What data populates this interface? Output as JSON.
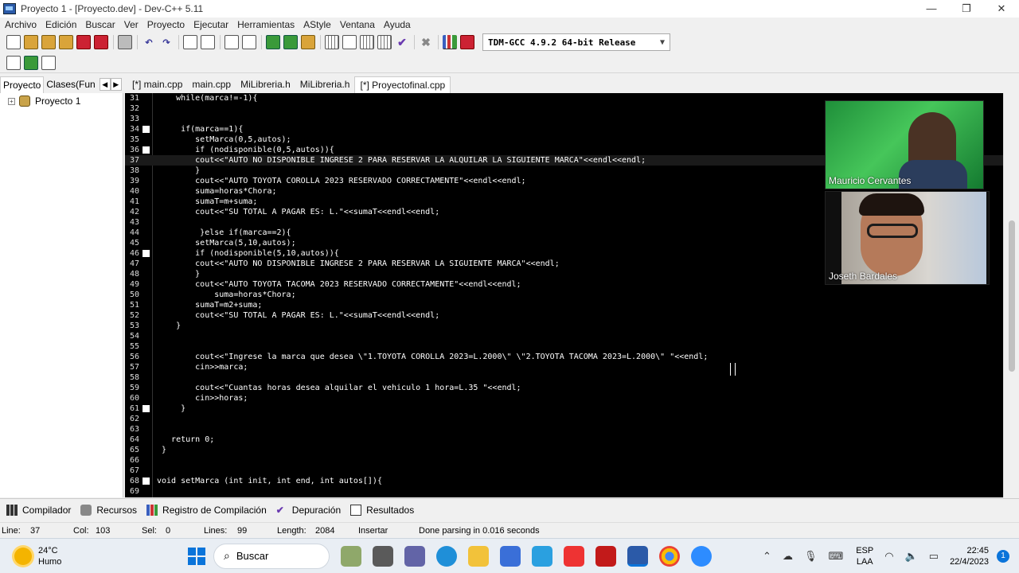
{
  "window": {
    "title": "Proyecto 1 - [Proyecto.dev] - Dev-C++ 5.11",
    "minimize": "—",
    "maximize": "❐",
    "close": "✕"
  },
  "menu": [
    "Archivo",
    "Edición",
    "Buscar",
    "Ver",
    "Proyecto",
    "Ejecutar",
    "Herramientas",
    "AStyle",
    "Ventana",
    "Ayuda"
  ],
  "toolbar": {
    "compiler": "TDM-GCC 4.9.2 64-bit Release",
    "icons": [
      "new-file-icon",
      "open-icon",
      "save-icon",
      "save-all-icon",
      "close-icon",
      "close-all-icon",
      "print-icon",
      "undo-icon",
      "redo-icon",
      "find-icon",
      "replace-icon",
      "indent-icon",
      "unindent-icon",
      "goto-icon",
      "toggle-bookmark-icon",
      "compile-icon",
      "run-icon",
      "compile-run-icon",
      "rebuild-icon",
      "grid-icon",
      "check-icon",
      "stop-icon",
      "chart-icon",
      "debug-icon"
    ]
  },
  "left_tabs": [
    "Proyecto",
    "Clases(Fun"
  ],
  "editor_tabs": [
    "[*] main.cpp",
    "main.cpp",
    "MiLibreria.h",
    "MiLibreria.h",
    "[*] Proyectofinal.cpp"
  ],
  "project_tree": {
    "root": "Proyecto 1"
  },
  "editor": {
    "current_line": 37,
    "lines": [
      {
        "n": 31,
        "fold": false,
        "text": "    while(marca!=-1){",
        "color": "#ffffff"
      },
      {
        "n": 32,
        "fold": false,
        "text": "",
        "color": "#ffffff"
      },
      {
        "n": 33,
        "fold": false,
        "text": "",
        "color": "#ffffff"
      },
      {
        "n": 34,
        "fold": true,
        "text": "     if(marca==1){",
        "color": "#ffffff"
      },
      {
        "n": 35,
        "fold": false,
        "text": "        setMarca(0,5,autos);",
        "color": "#ffffff"
      },
      {
        "n": 36,
        "fold": true,
        "text": "        if (nodisponible(0,5,autos)){",
        "color": "#ffffff"
      },
      {
        "n": 37,
        "fold": false,
        "text": "        cout<<\"AUTO NO DISPONIBLE INGRESE 2 PARA RESERVAR LA ALQUILAR LA SIGUIENTE MARCA\"<<endl<<endl;",
        "color": "#ffffff"
      },
      {
        "n": 38,
        "fold": false,
        "text": "        }",
        "color": "#ffffff"
      },
      {
        "n": 39,
        "fold": false,
        "text": "        cout<<\"AUTO TOYOTA COROLLA 2023 RESERVADO CORRECTAMENTE\"<<endl<<endl;",
        "color": "#ffffff"
      },
      {
        "n": 40,
        "fold": false,
        "text": "        suma=horas*Chora;",
        "color": "#ffffff"
      },
      {
        "n": 41,
        "fold": false,
        "text": "        sumaT=m+suma;",
        "color": "#ffffff"
      },
      {
        "n": 42,
        "fold": false,
        "text": "        cout<<\"SU TOTAL A PAGAR ES: L.\"<<sumaT<<endl<<endl;",
        "color": "#ffffff"
      },
      {
        "n": 43,
        "fold": false,
        "text": "",
        "color": "#ffffff"
      },
      {
        "n": 44,
        "fold": false,
        "text": "         }else if(marca==2){",
        "color": "#ffffff"
      },
      {
        "n": 45,
        "fold": false,
        "text": "        setMarca(5,10,autos);",
        "color": "#ffffff"
      },
      {
        "n": 46,
        "fold": true,
        "text": "        if (nodisponible(5,10,autos)){",
        "color": "#ffffff"
      },
      {
        "n": 47,
        "fold": false,
        "text": "        cout<<\"AUTO NO DISPONIBLE INGRESE 2 PARA RESERVAR LA SIGUIENTE MARCA\"<<endl;",
        "color": "#ffffff"
      },
      {
        "n": 48,
        "fold": false,
        "text": "        }",
        "color": "#ffffff"
      },
      {
        "n": 49,
        "fold": false,
        "text": "        cout<<\"AUTO TOYOTA TACOMA 2023 RESERVADO CORRECTAMENTE\"<<endl<<endl;",
        "color": "#ffffff"
      },
      {
        "n": 50,
        "fold": false,
        "text": "            suma=horas*Chora;",
        "color": "#ffffff"
      },
      {
        "n": 51,
        "fold": false,
        "text": "        sumaT=m2+suma;",
        "color": "#ffffff"
      },
      {
        "n": 52,
        "fold": false,
        "text": "        cout<<\"SU TOTAL A PAGAR ES: L.\"<<sumaT<<endl<<endl;",
        "color": "#ffffff"
      },
      {
        "n": 53,
        "fold": false,
        "text": "    }",
        "color": "#ffffff"
      },
      {
        "n": 54,
        "fold": false,
        "text": "",
        "color": "#ffffff"
      },
      {
        "n": 55,
        "fold": false,
        "text": "",
        "color": "#ffffff"
      },
      {
        "n": 56,
        "fold": false,
        "text": "        cout<<\"Ingrese la marca que desea \\\"1.TOYOTA COROLLA 2023=L.2000\\\" \\\"2.TOYOTA TACOMA 2023=L.2000\\\" \"<<endl;",
        "color": "#ffffff"
      },
      {
        "n": 57,
        "fold": false,
        "text": "        cin>>marca;",
        "color": "#ffffff"
      },
      {
        "n": 58,
        "fold": false,
        "text": "",
        "color": "#ffffff"
      },
      {
        "n": 59,
        "fold": false,
        "text": "        cout<<\"Cuantas horas desea alquilar el vehiculo 1 hora=L.35 \"<<endl;",
        "color": "#ffffff"
      },
      {
        "n": 60,
        "fold": false,
        "text": "        cin>>horas;",
        "color": "#ffffff"
      },
      {
        "n": 61,
        "fold": true,
        "text": "     }",
        "color": "#ffffff"
      },
      {
        "n": 62,
        "fold": false,
        "text": "",
        "color": "#ffffff"
      },
      {
        "n": 63,
        "fold": false,
        "text": "",
        "color": "#ffffff"
      },
      {
        "n": 64,
        "fold": false,
        "text": "   return 0;",
        "color": "#ffffff"
      },
      {
        "n": 65,
        "fold": false,
        "text": " }",
        "color": "#ffffff"
      },
      {
        "n": 66,
        "fold": false,
        "text": "",
        "color": "#ffffff"
      },
      {
        "n": 67,
        "fold": false,
        "text": "",
        "color": "#ffffff"
      },
      {
        "n": 68,
        "fold": true,
        "text": "void setMarca (int init, int end, int autos[]){",
        "color": "#ffffff"
      },
      {
        "n": 69,
        "fold": false,
        "text": "",
        "color": "#ffffff"
      }
    ]
  },
  "video_call": {
    "participant_1": "Mauricio Cervantes",
    "participant_2": "Joseth Bardales"
  },
  "bottom_tabs": [
    "Compilador",
    "Recursos",
    "Registro de Compilación",
    "Depuración",
    "Resultados"
  ],
  "status": {
    "line": "Line:",
    "line_val": "37",
    "col": "Col:",
    "col_val": "103",
    "sel": "Sel:",
    "sel_val": "0",
    "lines": "Lines:",
    "lines_val": "99",
    "length": "Length:",
    "length_val": "2084",
    "mode": "Insertar",
    "message": "Done parsing in 0.016 seconds"
  },
  "taskbar": {
    "temp": "24°C",
    "weather": "Humo",
    "search": "Buscar",
    "lang_1": "ESP",
    "lang_2": "LAA",
    "time": "22:45",
    "date": "22/4/2023",
    "notifications": "1"
  }
}
